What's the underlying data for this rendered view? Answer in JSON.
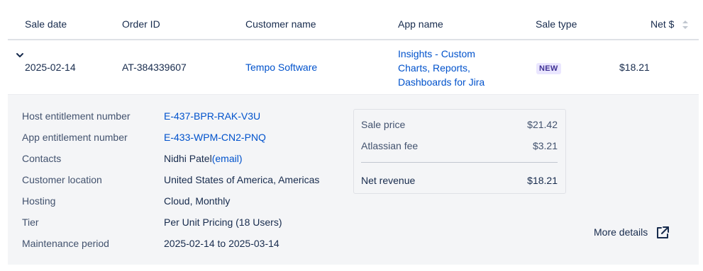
{
  "header": {
    "sale_date": "Sale date",
    "order_id": "Order ID",
    "customer_name": "Customer name",
    "app_name": "App name",
    "sale_type": "Sale type",
    "net": "Net $"
  },
  "row": {
    "sale_date": "2025-02-14",
    "order_id": "AT-384339607",
    "customer_name": "Tempo Software",
    "app_name": "Insights - Custom Charts, Reports, Dashboards for Jira",
    "sale_type": "NEW",
    "net": "$18.21"
  },
  "details": {
    "host_entitlement_label": "Host entitlement number",
    "host_entitlement_value": "E-437-BPR-RAK-V3U",
    "app_entitlement_label": "App entitlement number",
    "app_entitlement_value": "E-433-WPM-CN2-PNQ",
    "contacts_label": "Contacts",
    "contacts_name": "Nidhi Patel",
    "contacts_email": "(email)",
    "location_label": "Customer location",
    "location_value": "United States of America, Americas",
    "hosting_label": "Hosting",
    "hosting_value": "Cloud, Monthly",
    "tier_label": "Tier",
    "tier_value": "Per Unit Pricing (18 Users)",
    "maintenance_label": "Maintenance period",
    "maintenance_value": "2025-02-14 to 2025-03-14"
  },
  "pricing": {
    "sale_price_label": "Sale price",
    "sale_price_value": "$21.42",
    "fee_label": "Atlassian fee",
    "fee_value": "$3.21",
    "net_revenue_label": "Net revenue",
    "net_revenue_value": "$18.21"
  },
  "more_details": "More details",
  "icons": {
    "expand": "chevron-down-icon",
    "sort": "sort-icon",
    "external": "external-link-icon"
  },
  "colors": {
    "link": "#0052cc",
    "badge_bg": "#eae6ff",
    "badge_text": "#403294",
    "detail_bg": "#f4f5f7"
  }
}
